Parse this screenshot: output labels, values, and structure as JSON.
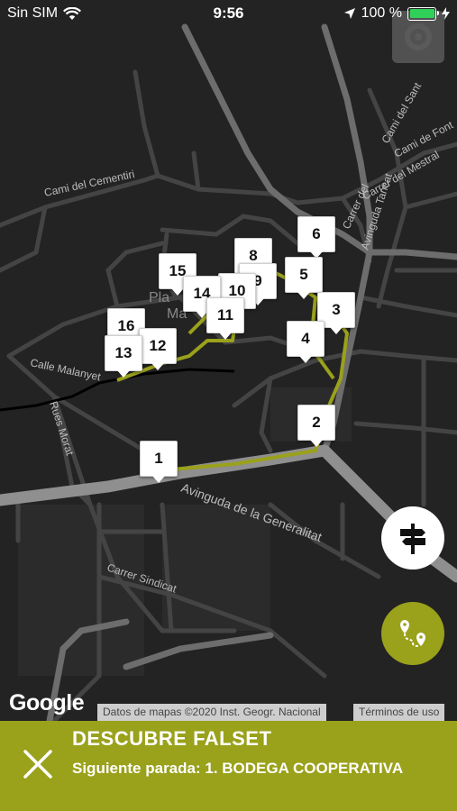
{
  "status_bar": {
    "carrier": "Sin SIM",
    "time": "9:56",
    "battery": "100 %"
  },
  "map": {
    "street_labels": [
      "Cami del Cementiri",
      "Calle Malanyet",
      "Rues Morat",
      "Avinguda de la Generalitat",
      "Carrer Sindicat",
      "Carrer del Mestral",
      "Cami de Font",
      "Cami del Sant",
      "Avinguda Tancat",
      "Carrer del",
      "Pla",
      "Ma"
    ],
    "route_color": "#9aa11b",
    "stops": [
      {
        "label": "1"
      },
      {
        "label": "2"
      },
      {
        "label": "3"
      },
      {
        "label": "4"
      },
      {
        "label": "5"
      },
      {
        "label": "6"
      },
      {
        "label": "8"
      },
      {
        "label": "9"
      },
      {
        "label": "10"
      },
      {
        "label": "11"
      },
      {
        "label": "12"
      },
      {
        "label": "13"
      },
      {
        "label": "14"
      },
      {
        "label": "15"
      },
      {
        "label": "16"
      }
    ]
  },
  "google": {
    "logo": "Google",
    "attribution": "Datos de mapas ©2020 Inst. Geogr. Nacional",
    "terms": "Términos de uso"
  },
  "buttons": {
    "signpost_icon": "signpost-icon",
    "route_icon": "route-icon"
  },
  "bottom_bar": {
    "title": "DESCUBRE FALSET",
    "next_stop": "Siguiente parada: 1. BODEGA COOPERATIVA",
    "accent": "#9aa11b"
  }
}
